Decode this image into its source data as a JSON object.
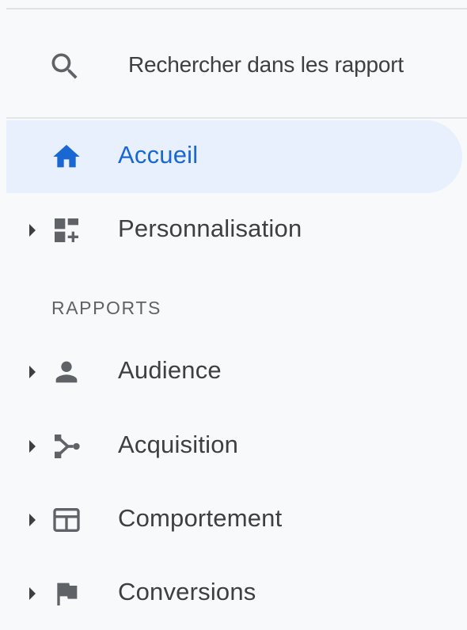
{
  "search": {
    "placeholder": "Rechercher dans les rapport"
  },
  "nav": {
    "home": {
      "label": "Accueil"
    },
    "customization": {
      "label": "Personnalisation"
    }
  },
  "reports": {
    "header": "RAPPORTS",
    "items": [
      {
        "label": "Audience",
        "icon": "person-icon"
      },
      {
        "label": "Acquisition",
        "icon": "acquisition-icon"
      },
      {
        "label": "Comportement",
        "icon": "behavior-icon"
      },
      {
        "label": "Conversions",
        "icon": "flag-icon"
      }
    ]
  },
  "colors": {
    "accent": "#1967d2",
    "active_bg": "#e8f0fe",
    "icon": "#5f6368",
    "text": "#3c4043",
    "background": "#f8f9fa"
  }
}
